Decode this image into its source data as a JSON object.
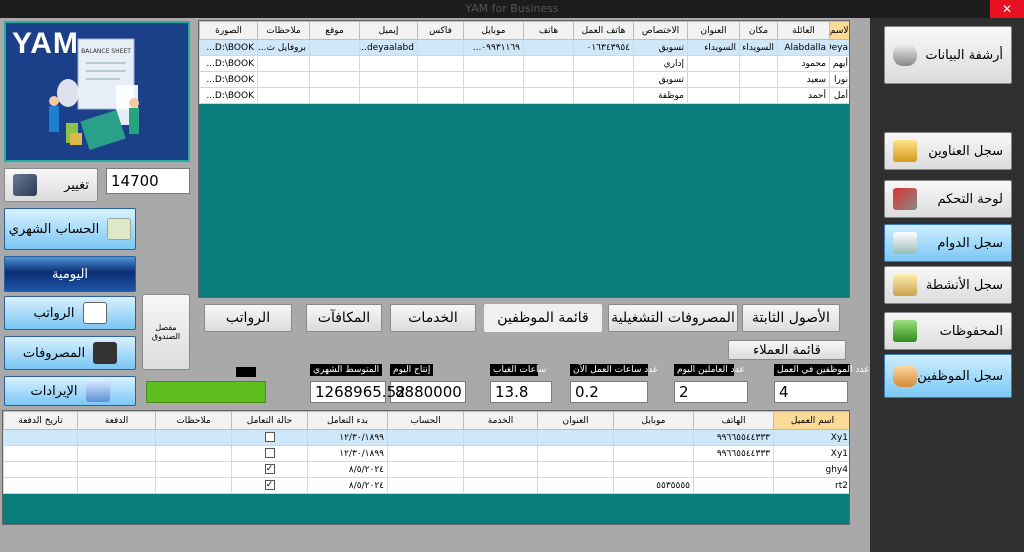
{
  "window": {
    "title": "YAM for Business",
    "close": "✕"
  },
  "logo": {
    "text": "YAM",
    "sheet_label": "BALANCE SHEET"
  },
  "change_button": "تغيير",
  "balance_value": "14700",
  "left_buttons": {
    "monthly": "الحساب الشهري",
    "daily": "اليومية",
    "salaries": "الرواتب",
    "expenses": "المصروفات",
    "revenues": "الإيرادات"
  },
  "cash_box_button": "مفصل الصندوق",
  "employee_table": {
    "headers": [
      "الاسم",
      "العائلة",
      "مكان",
      "العنوان",
      "الاختصاص",
      "هاتف العمل",
      "هاتف",
      "موبايل",
      "فاكس",
      "إيميل",
      "موقع",
      "ملاحظات",
      "الصورة"
    ],
    "rows": [
      [
        "Deya",
        "Alabdalla",
        "السويداء",
        "السويداء",
        "تسويق",
        "٠١٦٣٤٣٩٥٤",
        "",
        "٠٩٩٣١١٦٩...",
        "",
        "deyaalabd...",
        "",
        "بروفايل ث...",
        "D:\\BOOK..."
      ],
      [
        "أيهم",
        "محمود",
        "",
        "",
        "إداري",
        "",
        "",
        "",
        "",
        "",
        "",
        "",
        "D:\\BOOK..."
      ],
      [
        "نورا",
        "سعيد",
        "",
        "",
        "تسويق",
        "",
        "",
        "",
        "",
        "",
        "",
        "",
        "D:\\BOOK..."
      ],
      [
        "أمل",
        "أحمد",
        "",
        "",
        "موظفة",
        "",
        "",
        "",
        "",
        "",
        "",
        "",
        "D:\\BOOK..."
      ]
    ]
  },
  "tabs": [
    "الأصول الثابتة",
    "المصروفات التشغيلية",
    "قائمة الموظفين",
    "الخدمات",
    "المكافآت",
    "الرواتب"
  ],
  "customers_button": "قائمة العملاء",
  "stats": [
    {
      "label": "عدد الموظفين في العمل",
      "value": "4"
    },
    {
      "label": "عدد العاملين اليوم",
      "value": "2"
    },
    {
      "label": "عدد ساعات العمل الآن",
      "value": "0.2"
    },
    {
      "label": "ساعات الغياب",
      "value": "13.8"
    },
    {
      "label": "إنتاج اليوم",
      "value": "8880000"
    },
    {
      "label": "المتوسط الشهري",
      "value": "1268965.52"
    }
  ],
  "customer_table": {
    "headers": [
      "اسم العميل",
      "الهاتف",
      "موبايل",
      "العنوان",
      "الخدمة",
      "الحساب",
      "بدء التعامل",
      "حالة التعامل",
      "ملاحظات",
      "الدفعة",
      "تاريخ الدفعة"
    ],
    "rows": [
      {
        "cells": [
          "Xy1",
          "٩٩٦٦٥٥٤٤٣٣٣",
          "",
          "",
          "",
          "",
          "١٢/٣٠/١٨٩٩",
          "",
          "",
          "",
          ""
        ],
        "checked": false
      },
      {
        "cells": [
          "Xy1",
          "٩٩٦٦٥٥٤٤٣٣٣",
          "",
          "",
          "",
          "",
          "١٢/٣٠/١٨٩٩",
          "",
          "",
          "",
          ""
        ],
        "checked": false
      },
      {
        "cells": [
          "ghy4",
          "",
          "",
          "",
          "",
          "",
          "٨/٥/٢٠٢٤",
          "",
          "",
          "",
          ""
        ],
        "checked": true
      },
      {
        "cells": [
          "rt2",
          "",
          "٥٥٣٥٥٥٥",
          "",
          "",
          "",
          "٨/٥/٢٠٢٤",
          "",
          "",
          "",
          ""
        ],
        "checked": true
      }
    ]
  },
  "right_buttons": [
    "أرشفة البيانات",
    "سجل العناوين",
    "لوحة التحكم",
    "سجل الدوام",
    "سجل الأنشطة",
    "المحفوظات",
    "سجل الموظفين"
  ],
  "colors": {
    "teal": "#087d7b",
    "progress": "#5fbf1e"
  }
}
